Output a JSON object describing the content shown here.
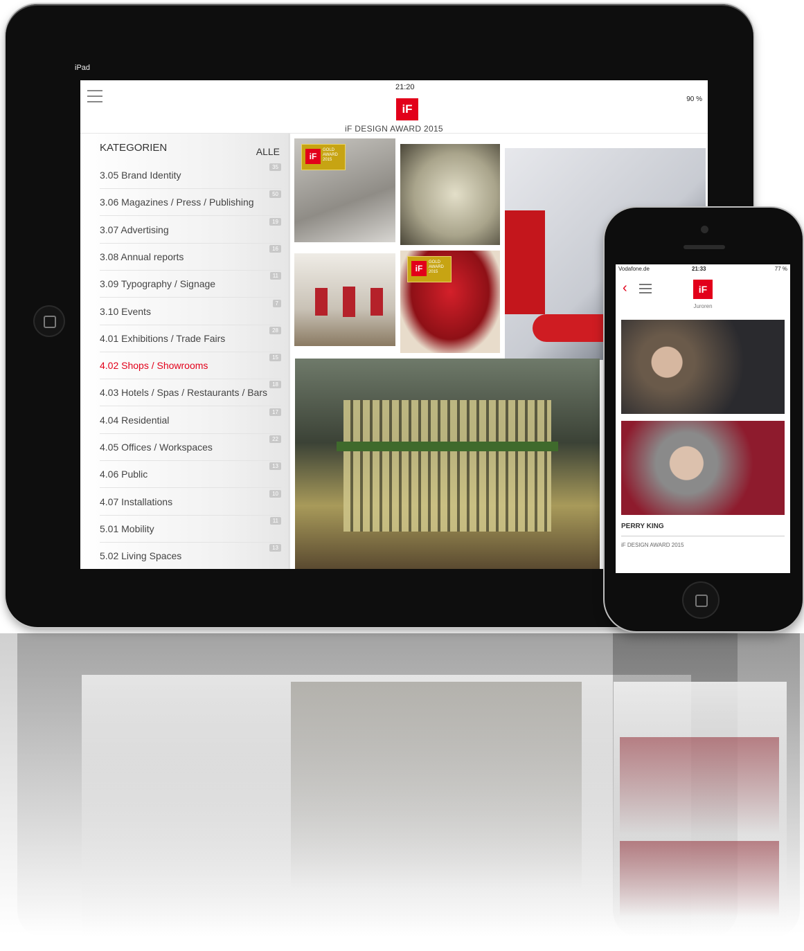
{
  "ipad": {
    "status_left": "iPad",
    "time": "21:20",
    "battery": "90 %",
    "logo": "iF",
    "title": "iF DESIGN AWARD 2015",
    "sidebar": {
      "heading": "KATEGORIEN",
      "all_label": "ALLE",
      "items": [
        {
          "label": "3.05 Brand Identity",
          "count": "35"
        },
        {
          "label": "3.06 Magazines / Press / Publishing",
          "count": "50"
        },
        {
          "label": "3.07 Advertising",
          "count": "19"
        },
        {
          "label": "3.08 Annual reports",
          "count": "16"
        },
        {
          "label": "3.09 Typography / Signage",
          "count": "11"
        },
        {
          "label": "3.10 Events",
          "count": "7"
        },
        {
          "label": "4.01 Exhibitions / Trade Fairs",
          "count": "28"
        },
        {
          "label": "4.02  Shops / Showrooms",
          "count": "15",
          "active": true
        },
        {
          "label": "4.03 Hotels / Spas / Restaurants / Bars",
          "count": "18"
        },
        {
          "label": "4.04 Residential",
          "count": "17"
        },
        {
          "label": "4.05 Offices / Workspaces",
          "count": "22"
        },
        {
          "label": "4.06 Public",
          "count": "13"
        },
        {
          "label": "4.07 Installations",
          "count": "10"
        },
        {
          "label": "5.01 Mobility",
          "count": "11"
        },
        {
          "label": "5.02 Living Spaces",
          "count": "13"
        }
      ]
    },
    "gold_badge": {
      "logo": "iF",
      "text": "GOLD AWARD 2015"
    }
  },
  "iphone": {
    "carrier": "Vodafone.de",
    "time": "21:33",
    "battery": "77 %",
    "logo": "iF",
    "subtitle": "Juroren",
    "person_name": "PERRY KING",
    "award": "iF DESIGN AWARD 2015"
  },
  "colors": {
    "accent": "#e2001a",
    "gold": "#c7a413"
  },
  "icons": [
    "hamburger-icon",
    "back-chevron-icon",
    "wifi-icon",
    "battery-icon",
    "home-button-icon"
  ]
}
